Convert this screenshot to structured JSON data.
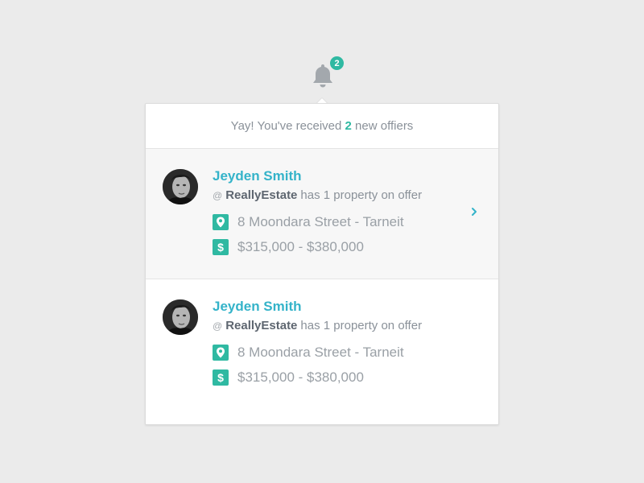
{
  "bell": {
    "icon": "bell-icon",
    "badge_count": "2",
    "badge_color": "#2fb9a2"
  },
  "panel": {
    "header": {
      "prefix": "Yay! You've received",
      "count": "2",
      "suffix": "new offiers"
    },
    "offers": [
      {
        "name": "Jeyden Smith",
        "at_symbol": "@",
        "agency": "ReallyEstate",
        "offer_text": "has 1 property on offer",
        "address_icon": "map-pin-icon",
        "address": "8 Moondara Street - Tarneit",
        "price_icon": "dollar-icon",
        "price_glyph": "$",
        "price": "$315,000 - $380,000",
        "active": true
      },
      {
        "name": "Jeyden Smith",
        "at_symbol": "@",
        "agency": "ReallyEstate",
        "offer_text": "has 1 property on offer",
        "address_icon": "map-pin-icon",
        "address": "8 Moondara Street - Tarneit",
        "price_icon": "dollar-icon",
        "price_glyph": "$",
        "price": "$315,000 - $380,000",
        "active": false
      }
    ]
  },
  "colors": {
    "accent_teal": "#2fb9a2",
    "name_blue": "#34b3c9",
    "text_gray": "#9aa0a6",
    "background": "#ebebeb"
  }
}
